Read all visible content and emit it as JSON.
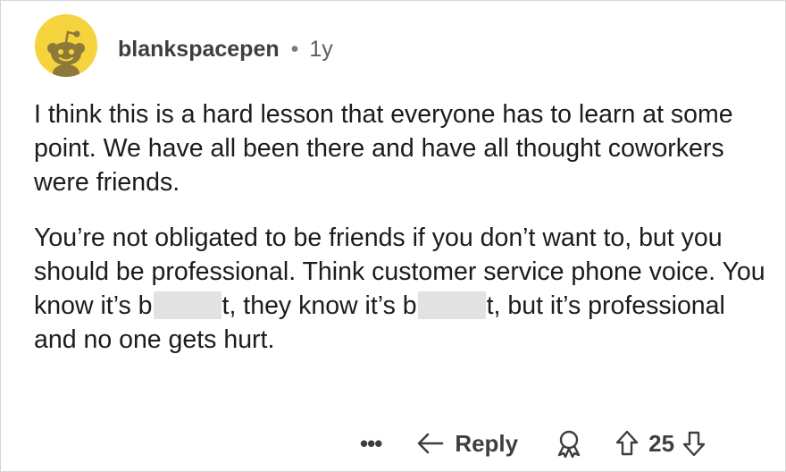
{
  "comment": {
    "author": "blankspacepen",
    "separator": "•",
    "age": "1y",
    "body": {
      "paragraph1": "I think this is a hard lesson that everyone has to learn at some point.  We have all been there and have all thought coworkers were friends.",
      "paragraph2": {
        "part1": "You’re not obligated to be friends if you don’t want to, but you should be professional. Think customer service phone voice.  You know it’s b",
        "part2": "t,  they know it’s b",
        "part3": "t, but it’s professional and no one gets hurt."
      }
    },
    "actions": {
      "more_label": "•••",
      "reply_label": "Reply",
      "vote_count": "25"
    }
  },
  "colors": {
    "avatar_bg": "#f5d33c",
    "text": "#1c1c1c",
    "meta": "#4b4f53",
    "redaction": "#e2e2e2"
  },
  "icons": {
    "avatar": "reddit-snoo-avatar",
    "reply": "reply-arrow-icon",
    "award": "award-icon",
    "upvote": "upvote-arrow-icon",
    "downvote": "downvote-arrow-icon"
  }
}
